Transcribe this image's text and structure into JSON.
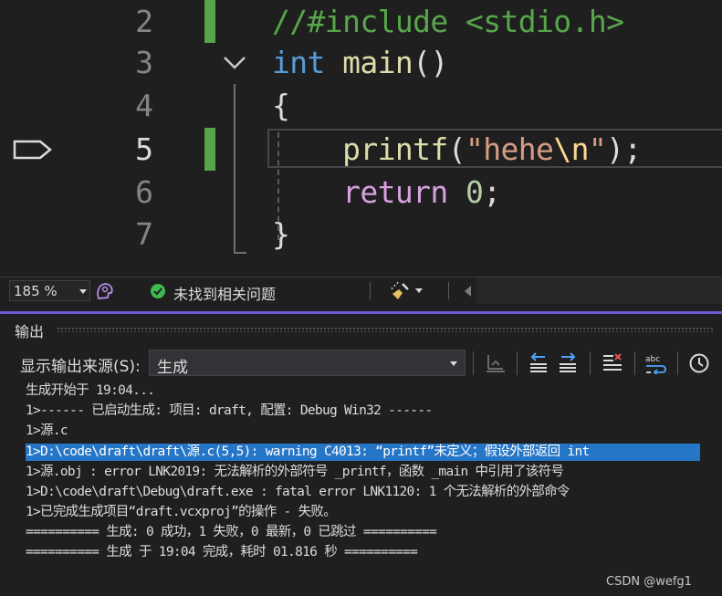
{
  "editor": {
    "lines": [
      {
        "num": "2",
        "tokens": [
          {
            "t": "//#include <stdio.h>",
            "c": "comment"
          }
        ]
      },
      {
        "num": "3",
        "tokens": [
          {
            "t": "int",
            "c": "kw"
          },
          {
            "t": " ",
            "c": "pun"
          },
          {
            "t": "main",
            "c": "fn"
          },
          {
            "t": "()",
            "c": "pun"
          }
        ]
      },
      {
        "num": "4",
        "tokens": [
          {
            "t": "{",
            "c": "pun"
          }
        ]
      },
      {
        "num": "5",
        "tokens": [
          {
            "t": "    ",
            "c": "pun"
          },
          {
            "t": "printf",
            "c": "fn"
          },
          {
            "t": "(",
            "c": "pun"
          },
          {
            "t": "\"hehe",
            "c": "str"
          },
          {
            "t": "\\n",
            "c": "esc"
          },
          {
            "t": "\"",
            "c": "str"
          },
          {
            "t": ");",
            "c": "pun"
          }
        ]
      },
      {
        "num": "6",
        "tokens": [
          {
            "t": "    ",
            "c": "pun"
          },
          {
            "t": "return",
            "c": "ctl"
          },
          {
            "t": " ",
            "c": "pun"
          },
          {
            "t": "0",
            "c": "num"
          },
          {
            "t": ";",
            "c": "pun"
          }
        ]
      },
      {
        "num": "7",
        "tokens": [
          {
            "t": "}",
            "c": "pun"
          }
        ]
      }
    ],
    "active_line": "5"
  },
  "status_bar": {
    "zoom": "185 %",
    "issues_text": "未找到相关问题"
  },
  "output_panel": {
    "title": "输出",
    "source_label": "显示输出来源(S):",
    "source_value": "生成",
    "lines": [
      {
        "text": "生成开始于 19:04...",
        "highlighted": false
      },
      {
        "text": "1>------ 已启动生成: 项目: draft, 配置: Debug Win32 ------",
        "highlighted": false
      },
      {
        "text": "1>源.c",
        "highlighted": false
      },
      {
        "text": "1>D:\\code\\draft\\draft\\源.c(5,5): warning C4013: “printf”未定义；假设外部返回 int",
        "highlighted": true
      },
      {
        "text": "1>源.obj : error LNK2019: 无法解析的外部符号 _printf，函数 _main 中引用了该符号",
        "highlighted": false
      },
      {
        "text": "1>D:\\code\\draft\\Debug\\draft.exe : fatal error LNK1120: 1 个无法解析的外部命令",
        "highlighted": false
      },
      {
        "text": "1>已完成生成项目“draft.vcxproj”的操作 - 失败。",
        "highlighted": false
      },
      {
        "text": "========== 生成: 0 成功，1 失败，0 最新，0 已跳过 ==========",
        "highlighted": false
      },
      {
        "text": "========== 生成 于 19:04 完成，耗时 01.816 秒 ==========",
        "highlighted": false
      }
    ]
  },
  "watermark": "CSDN @wefg1",
  "colors": {
    "accent": "#6a5ad8",
    "selection": "#2676c8",
    "change_bar": "#57a64a",
    "ok_green": "#3fb950"
  }
}
